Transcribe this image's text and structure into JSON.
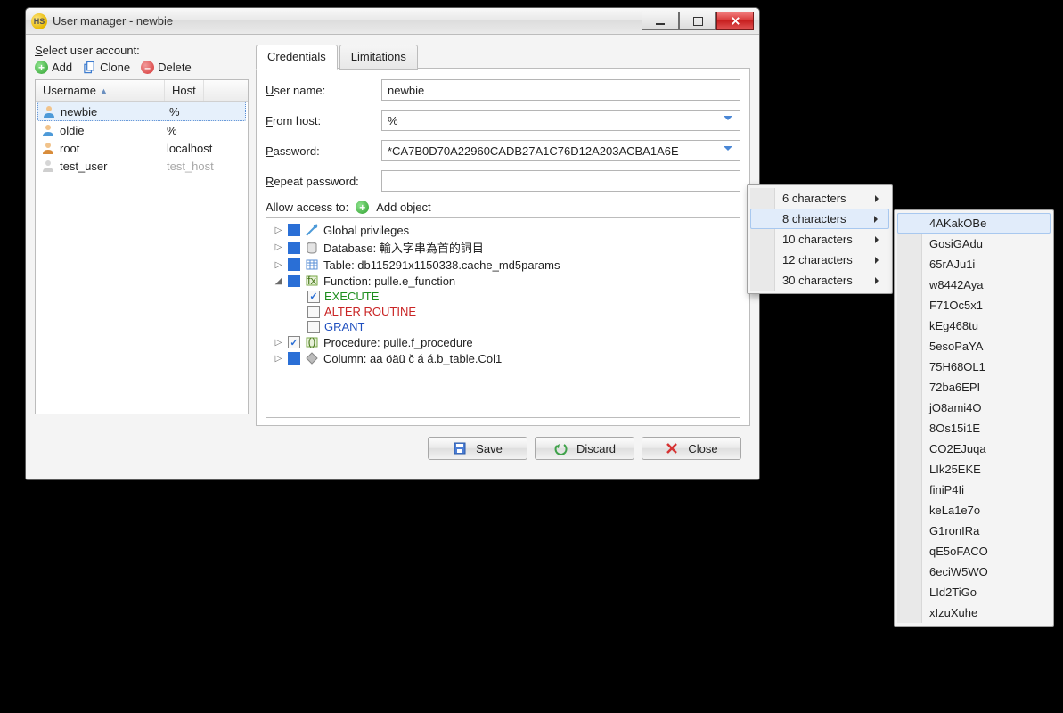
{
  "window": {
    "title": "User manager - newbie"
  },
  "left": {
    "select_label": "Select user account:",
    "add": "Add",
    "clone": "Clone",
    "delete": "Delete",
    "col_user": "Username",
    "col_host": "Host",
    "rows": [
      {
        "user": "newbie",
        "host": "%"
      },
      {
        "user": "oldie",
        "host": "%"
      },
      {
        "user": "root",
        "host": "localhost"
      },
      {
        "user": "test_user",
        "host": "test_host"
      }
    ]
  },
  "tabs": {
    "credentials": "Credentials",
    "limitations": "Limitations"
  },
  "form": {
    "user_label": "User name:",
    "user_value": "newbie",
    "host_label": "From host:",
    "host_value": "%",
    "pass_label": "Password:",
    "pass_value": "*CA7B0D70A22960CADB27A1C76D12A203ACBA1A6E",
    "repeat_label": "Repeat password:",
    "repeat_value": ""
  },
  "allow": {
    "label": "Allow access to:",
    "add_object": "Add object"
  },
  "tree": {
    "n0": "Global privileges",
    "n1": "Database: 輸入字串為首的詞目",
    "n2": "Table: db115291x1150338.cache_md5params",
    "n3": "Function: pulle.e_function",
    "n3a": "EXECUTE",
    "n3b": "ALTER ROUTINE",
    "n3c": "GRANT",
    "n4": "Procedure: pulle.f_procedure",
    "n5": "Column: aa öäü č á á.b_table.Col1"
  },
  "footer": {
    "save": "Save",
    "discard": "Discard",
    "close": "Close"
  },
  "menu1": [
    "6 characters",
    "8 characters",
    "10 characters",
    "12 characters",
    "30 characters"
  ],
  "menu2": [
    "4AKakOBe",
    "GosiGAdu",
    "65rAJu1i",
    "w8442Aya",
    "F71Oc5x1",
    "kEg468tu",
    "5esoPaYA",
    "75H68OL1",
    "72ba6EPI",
    "jO8ami4O",
    "8Os15i1E",
    "CO2EJuqa",
    "LIk25EKE",
    "finiP4Ii",
    "keLa1e7o",
    "G1ronIRa",
    "qE5oFACO",
    "6eciW5WO",
    "LId2TiGo",
    "xIzuXuhe"
  ]
}
